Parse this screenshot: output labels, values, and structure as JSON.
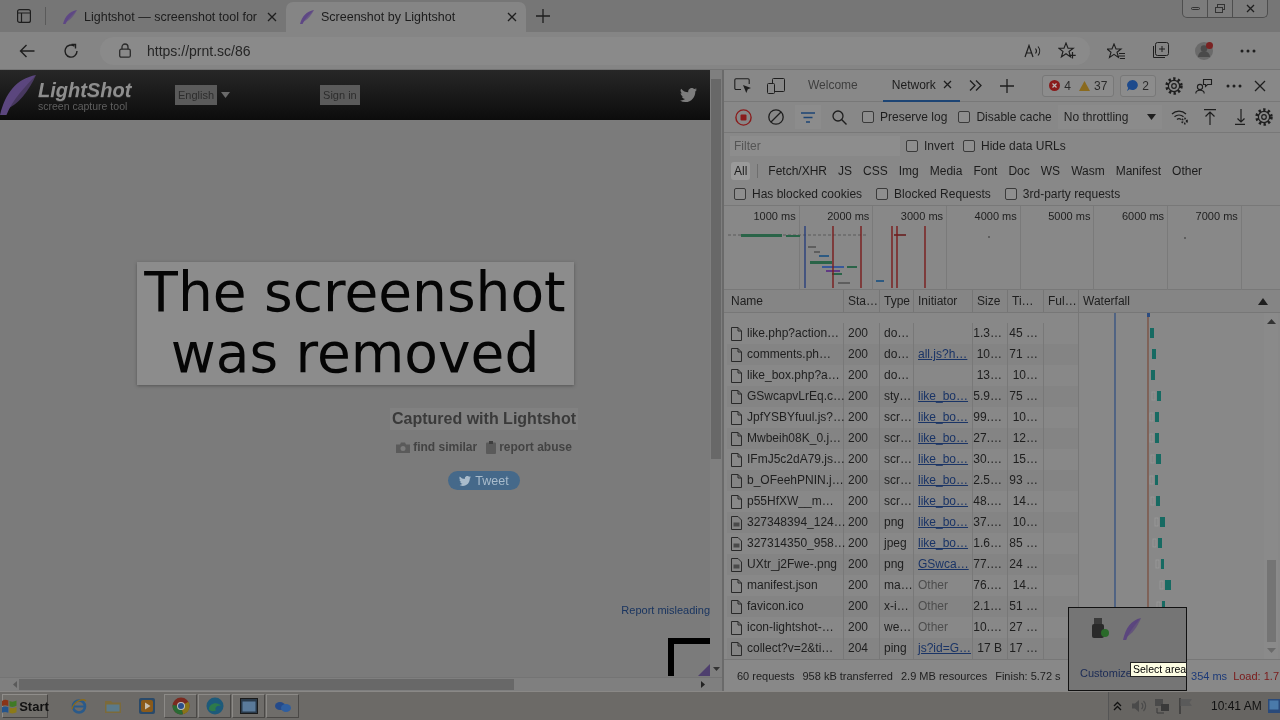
{
  "browser": {
    "tabs": [
      {
        "title": "Lightshot — screenshot tool for",
        "selected": false
      },
      {
        "title": "Screenshot by Lightshot",
        "selected": true
      }
    ],
    "address": "https://prnt.sc/86"
  },
  "page": {
    "logo": "LightShot",
    "tagline": "screen capture tool",
    "language": "English",
    "sign_in": "Sign in",
    "notice": "The screenshot was removed",
    "caption": "Captured with Lightshot",
    "actions": [
      {
        "kind": "similar",
        "label": "find similar"
      },
      {
        "kind": "abuse",
        "label": "report abuse"
      }
    ],
    "tweet": "Tweet",
    "report_link": "Report misleading"
  },
  "devtools": {
    "tabs": [
      {
        "label": "Welcome",
        "selected": false
      },
      {
        "label": "Network",
        "selected": true
      }
    ],
    "issues": {
      "errors": "4",
      "warnings": "37",
      "info": "2"
    },
    "recording": true,
    "options": [
      {
        "label": "Preserve log",
        "checked": false
      },
      {
        "label": "Disable cache",
        "checked": false
      }
    ],
    "throttling": "No throttling",
    "filter": {
      "placeholder": "Filter"
    },
    "filter_options": [
      {
        "label": "Invert",
        "checked": false
      },
      {
        "label": "Hide data URLs",
        "checked": false
      }
    ],
    "type_filters": [
      {
        "label": "All",
        "selected": true
      },
      {
        "label": "Fetch/XHR",
        "selected": false
      },
      {
        "label": "JS",
        "selected": false
      },
      {
        "label": "CSS",
        "selected": false
      },
      {
        "label": "Img",
        "selected": false
      },
      {
        "label": "Media",
        "selected": false
      },
      {
        "label": "Font",
        "selected": false
      },
      {
        "label": "Doc",
        "selected": false
      },
      {
        "label": "WS",
        "selected": false
      },
      {
        "label": "Wasm",
        "selected": false
      },
      {
        "label": "Manifest",
        "selected": false
      },
      {
        "label": "Other",
        "selected": false
      }
    ],
    "request_filters": [
      {
        "label": "Has blocked cookies",
        "checked": false
      },
      {
        "label": "Blocked Requests",
        "checked": false
      },
      {
        "label": "3rd-party requests",
        "checked": false
      }
    ],
    "overview_ticks": [
      "1000 ms",
      "2000 ms",
      "3000 ms",
      "4000 ms",
      "5000 ms",
      "6000 ms",
      "7000 ms"
    ],
    "columns": [
      "Name",
      "Sta…",
      "Type",
      "Initiator",
      "Size",
      "Ti…",
      "Ful…",
      "Waterfall"
    ],
    "rows": [
      {
        "name": "like.php?action…",
        "kind": "document",
        "status": "200",
        "type": "do…",
        "size": "1.3…",
        "time": "45 …"
      },
      {
        "name": "comments.ph…",
        "kind": "document",
        "status": "200",
        "type": "do…",
        "initiator": {
          "text": "all.js?h…",
          "kind": "link"
        },
        "size": "10…",
        "time": "71 …"
      },
      {
        "name": "like_box.php?a…",
        "kind": "document",
        "status": "200",
        "type": "do…",
        "size": "13…",
        "time": "10…"
      },
      {
        "name": "GSwcapvLrEq.c…",
        "kind": "document",
        "status": "200",
        "type": "sty…",
        "initiator": {
          "text": "like_bo…",
          "kind": "link"
        },
        "size": "5.9…",
        "time": "75 …"
      },
      {
        "name": "JpfYSBYfuul.js?…",
        "kind": "document",
        "status": "200",
        "type": "scr…",
        "initiator": {
          "text": "like_bo…",
          "kind": "link"
        },
        "size": "99.…",
        "time": "10…"
      },
      {
        "name": "Mwbeih08K_0.j…",
        "kind": "document",
        "status": "200",
        "type": "scr…",
        "initiator": {
          "text": "like_bo…",
          "kind": "link"
        },
        "size": "27.…",
        "time": "12…"
      },
      {
        "name": "IFmJ5c2dA79.js…",
        "kind": "document",
        "status": "200",
        "type": "scr…",
        "initiator": {
          "text": "like_bo…",
          "kind": "link"
        },
        "size": "30.…",
        "time": "15…"
      },
      {
        "name": "b_OFeehPNIN.j…",
        "kind": "document",
        "status": "200",
        "type": "scr…",
        "initiator": {
          "text": "like_bo…",
          "kind": "link"
        },
        "size": "2.5…",
        "time": "93 …"
      },
      {
        "name": "p55HfXW__m…",
        "kind": "document",
        "status": "200",
        "type": "scr…",
        "initiator": {
          "text": "like_bo…",
          "kind": "link"
        },
        "size": "48.…",
        "time": "14…"
      },
      {
        "name": "327348394_124…",
        "kind": "image",
        "status": "200",
        "type": "png",
        "initiator": {
          "text": "like_bo…",
          "kind": "link"
        },
        "size": "37.…",
        "time": "10…"
      },
      {
        "name": "327314350_958…",
        "kind": "image",
        "status": "200",
        "type": "jpeg",
        "initiator": {
          "text": "like_bo…",
          "kind": "link"
        },
        "size": "1.6…",
        "time": "85 …"
      },
      {
        "name": "UXtr_j2Fwe-.png",
        "kind": "image",
        "status": "200",
        "type": "png",
        "initiator": {
          "text": "GSwca…",
          "kind": "link"
        },
        "size": "77.…",
        "time": "24 …"
      },
      {
        "name": "manifest.json",
        "kind": "document",
        "status": "200",
        "type": "ma…",
        "initiator": {
          "text": "Other",
          "kind": "plain"
        },
        "size": "76.…",
        "time": "14…"
      },
      {
        "name": "favicon.ico",
        "kind": "document",
        "status": "200",
        "type": "x-i…",
        "initiator": {
          "text": "Other",
          "kind": "plain"
        },
        "size": "2.1…",
        "time": "51 …"
      },
      {
        "name": "icon-lightshot-…",
        "kind": "document",
        "status": "200",
        "type": "we…",
        "initiator": {
          "text": "Other",
          "kind": "plain"
        },
        "size": "10.…",
        "time": "27 …"
      },
      {
        "name": "collect?v=2&ti…",
        "kind": "document",
        "status": "204",
        "type": "ping",
        "initiator": {
          "text": "js?id=G…",
          "kind": "link"
        },
        "size": "17 B",
        "time": "17 …"
      }
    ],
    "status": [
      {
        "kind": "plain",
        "text": "60 requests"
      },
      {
        "kind": "plain",
        "text": "958 kB transferred"
      },
      {
        "kind": "plain",
        "text": "2.9 MB resources"
      },
      {
        "kind": "plain",
        "text": "Finish: 5.72 s"
      },
      {
        "kind": "dom",
        "text": "354 ms"
      },
      {
        "kind": "load",
        "text": "Load: 1.7"
      }
    ]
  },
  "tray_popup": {
    "link": "Customize",
    "tooltip": "Select area"
  },
  "taskbar": {
    "start": "Start",
    "clock": "10:41 AM"
  }
}
